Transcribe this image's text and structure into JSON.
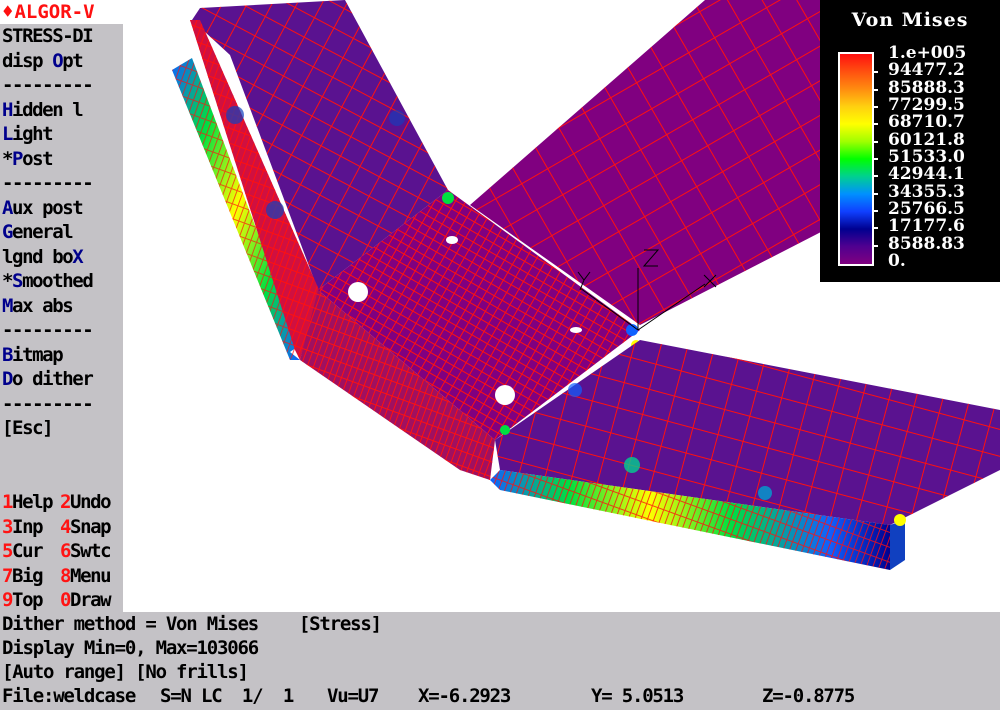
{
  "app": {
    "title": "ALGOR-V",
    "title_icon": "diamond-icon"
  },
  "menu": {
    "items": [
      {
        "text": "STRESS-DI",
        "hotkey": "",
        "rest": "STRESS-DI"
      },
      {
        "text": "disp Opt",
        "pre": "disp ",
        "hotkey": "O",
        "rest": "pt"
      },
      {
        "text": "---------",
        "separator": true
      },
      {
        "text": "Hidden l",
        "hotkey": "H",
        "rest": "idden l"
      },
      {
        "text": "Light",
        "hotkey": "L",
        "rest": "ight"
      },
      {
        "text": "*Post",
        "pre": "*",
        "hotkey": "P",
        "rest": "ost"
      },
      {
        "text": "---------",
        "separator": true
      },
      {
        "text": "Aux post",
        "hotkey": "A",
        "rest": "ux post"
      },
      {
        "text": "General",
        "hotkey": "G",
        "rest": "eneral"
      },
      {
        "text": "lgnd boX",
        "pre": "lgnd bo",
        "hotkey": "X",
        "rest": ""
      },
      {
        "text": "*Smoothed",
        "pre": "*",
        "hotkey": "S",
        "rest": "moothed"
      },
      {
        "text": "Max abs",
        "hotkey": "M",
        "rest": "ax abs"
      },
      {
        "text": "---------",
        "separator": true
      },
      {
        "text": "Bitmap",
        "hotkey": "B",
        "rest": "itmap"
      },
      {
        "text": "Do dither",
        "hotkey": "D",
        "rest": "o dither"
      },
      {
        "text": "---------",
        "separator": true
      },
      {
        "text": "[Esc]",
        "hotkey": "",
        "rest": "[Esc]"
      }
    ],
    "function_keys": [
      {
        "key": "1",
        "label": "Help"
      },
      {
        "key": "2",
        "label": "Undo"
      },
      {
        "key": "3",
        "label": "Inp"
      },
      {
        "key": "4",
        "label": "Snap"
      },
      {
        "key": "5",
        "label": "Cur"
      },
      {
        "key": "6",
        "label": "Swtc"
      },
      {
        "key": "7",
        "label": "Big"
      },
      {
        "key": "8",
        "label": "Menu"
      },
      {
        "key": "9",
        "label": "Top"
      },
      {
        "key": "0",
        "label": "Draw"
      }
    ]
  },
  "status": {
    "line1": "Dither method = Von Mises    [Stress]",
    "line2": "Display Min=0, Max=103066",
    "line3": "[Auto range] [No frills]",
    "file": "File:weldcase",
    "sn": "S=N LC  1/  1",
    "view": "Vu=U7",
    "x": "X=-6.2923",
    "y": "Y= 5.0513",
    "z": "Z=-0.8775"
  },
  "legend": {
    "title": "Von Mises",
    "labels": [
      "1.e+005",
      "94477.2",
      "85888.3",
      "77299.5",
      "68710.7",
      "60121.8",
      "51533.0",
      "42944.1",
      "34355.3",
      "25766.5",
      "17177.6",
      "8588.83",
      "0."
    ],
    "colors": [
      "#ff1010",
      "#ff5010",
      "#ff8c10",
      "#ffd010",
      "#ffff00",
      "#a0ff00",
      "#00ff00",
      "#00d090",
      "#0090ff",
      "#1040ff",
      "#000090",
      "#500090",
      "#800080"
    ]
  },
  "axes": {
    "x": "X",
    "y": "Y",
    "z": "Z"
  },
  "colors": {
    "background": "#c4c2c6",
    "hotkey": "#00008c",
    "fkey": "#ff1414",
    "mesh": "#ff1010",
    "low_stress": "#800080"
  }
}
